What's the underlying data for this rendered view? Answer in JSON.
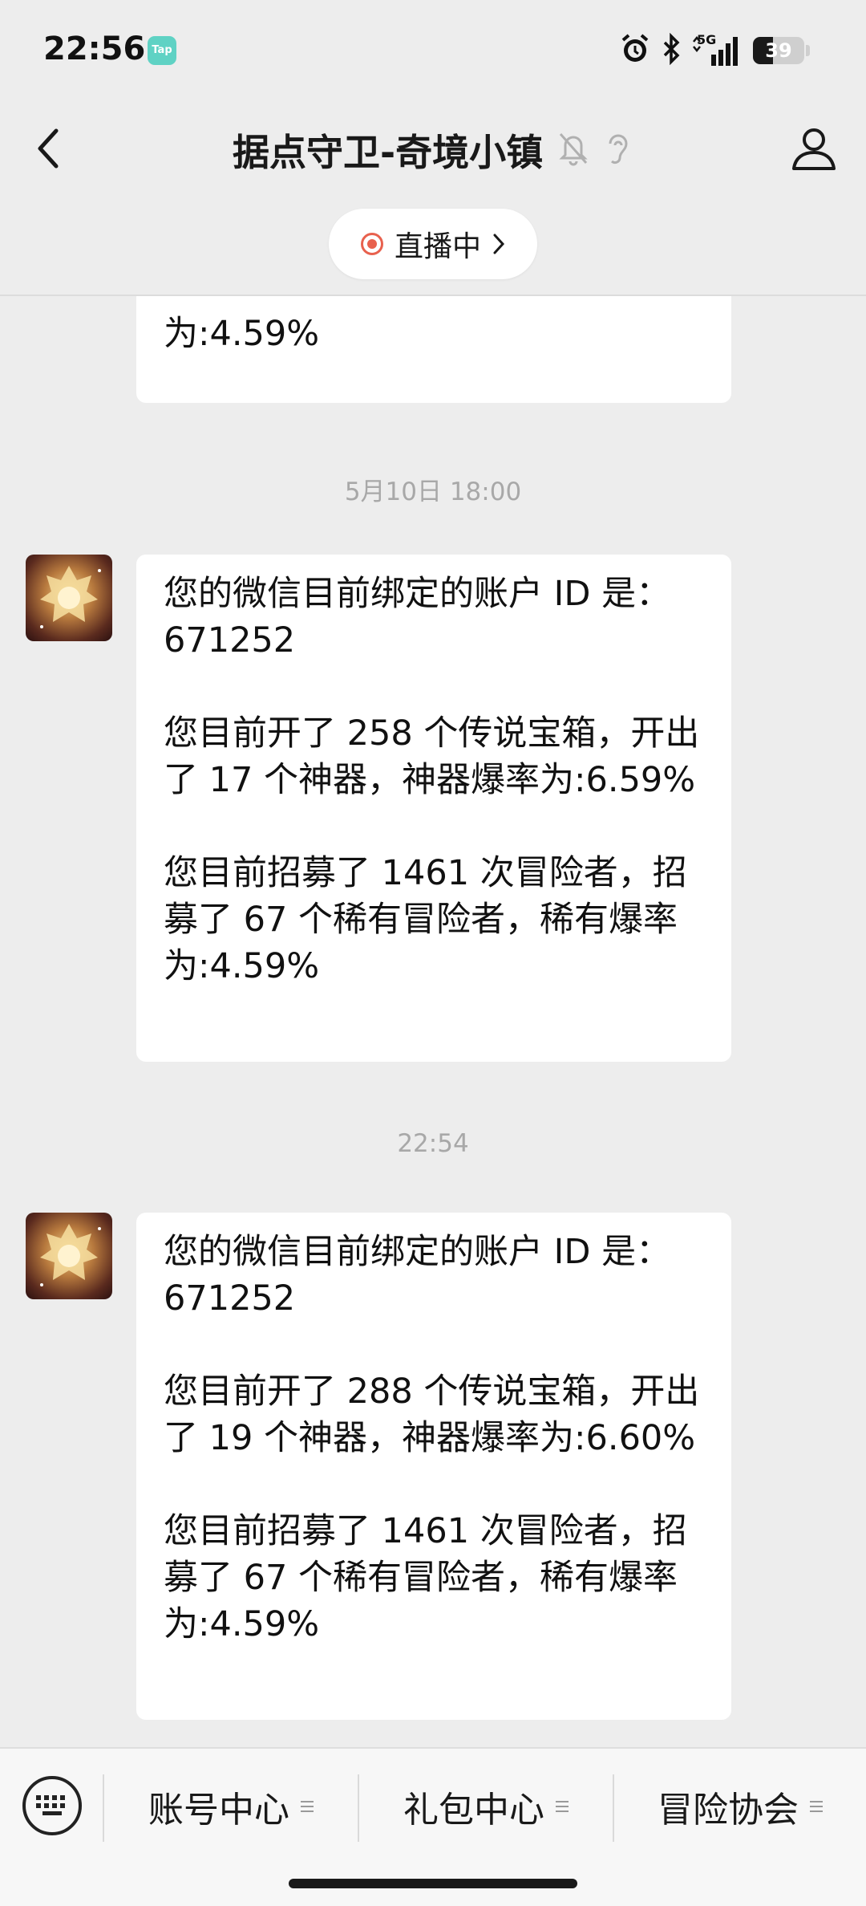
{
  "status_bar": {
    "time": "22:56",
    "app_badge": "Tap",
    "network": "5G",
    "battery_level": "39",
    "battery_fraction": 0.39
  },
  "nav": {
    "title": "据点守卫-奇境小镇",
    "icons": [
      "back-icon",
      "mute-bell-icon",
      "ear-icon",
      "profile-icon"
    ]
  },
  "live": {
    "label": "直播中"
  },
  "messages": [
    {
      "partial_text": "为:4.59%"
    },
    {
      "timestamp": "5月10日 18:00",
      "paragraphs": [
        "您的微信目前绑定的账户 ID 是：671252",
        "您目前开了 258 个传说宝箱，开出了 17 个神器，神器爆率为:6.59%",
        "您目前招募了 1461 次冒险者，招募了 67 个稀有冒险者，稀有爆率为:4.59%"
      ]
    },
    {
      "timestamp": "22:54",
      "paragraphs": [
        "您的微信目前绑定的账户 ID 是：671252",
        "您目前开了 288 个传说宝箱，开出了 19 个神器，神器爆率为:6.60%",
        "您目前招募了 1461 次冒险者，招募了 67 个稀有冒险者，稀有爆率为:4.59%"
      ]
    }
  ],
  "menu": {
    "items": [
      {
        "label": "账号中心"
      },
      {
        "label": "礼包中心"
      },
      {
        "label": "冒险协会"
      }
    ]
  },
  "colors": {
    "live_dot": "#e8614e",
    "background": "#ededed"
  }
}
